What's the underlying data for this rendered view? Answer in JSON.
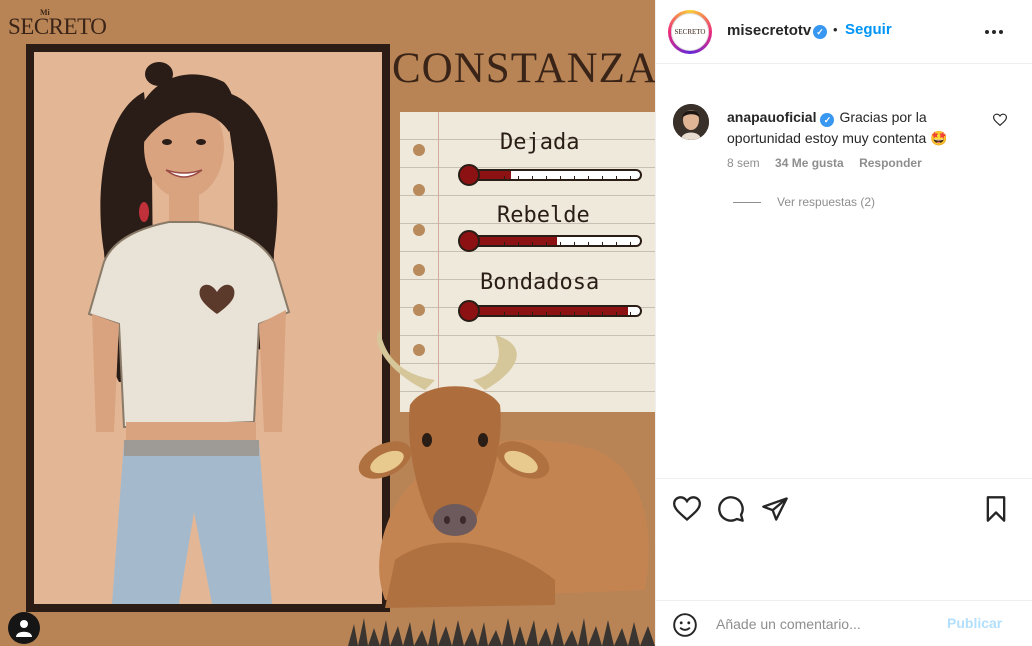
{
  "post": {
    "logo_small": "Mi",
    "logo_main": "SECRETO",
    "character_name": "CONSTANZA",
    "traits": [
      {
        "label": "Dejada",
        "level": 0.25
      },
      {
        "label": "Rebelde",
        "level": 0.52
      },
      {
        "label": "Bondadosa",
        "level": 0.93
      }
    ]
  },
  "header": {
    "avatar_text": "SECRETO",
    "username": "misecretotv",
    "separator": "•",
    "follow_label": "Seguir"
  },
  "comment": {
    "username": "anapauoficial",
    "text": "Gracias por la oportunidad estoy muy contenta 🤩",
    "time": "8 sem",
    "likes": "34 Me gusta",
    "reply_label": "Responder",
    "view_replies": "Ver respuestas (2)"
  },
  "add_comment": {
    "placeholder": "Añade un comentario...",
    "publish_label": "Publicar"
  },
  "colors": {
    "accent": "#0095f6",
    "background_tan": "#b88456",
    "thermo_red": "#8b1113"
  }
}
